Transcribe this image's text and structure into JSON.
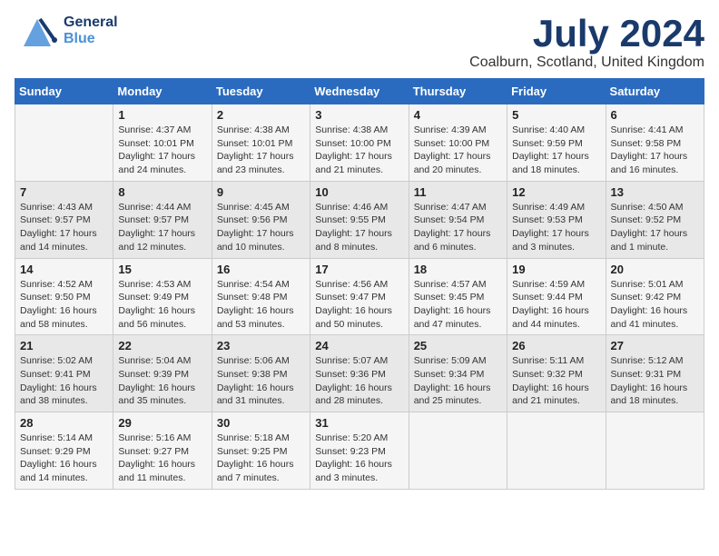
{
  "header": {
    "logo_line1": "General",
    "logo_line2": "Blue",
    "month": "July 2024",
    "location": "Coalburn, Scotland, United Kingdom"
  },
  "weekdays": [
    "Sunday",
    "Monday",
    "Tuesday",
    "Wednesday",
    "Thursday",
    "Friday",
    "Saturday"
  ],
  "weeks": [
    [
      {
        "day": "",
        "info": ""
      },
      {
        "day": "1",
        "info": "Sunrise: 4:37 AM\nSunset: 10:01 PM\nDaylight: 17 hours and 24 minutes."
      },
      {
        "day": "2",
        "info": "Sunrise: 4:38 AM\nSunset: 10:01 PM\nDaylight: 17 hours and 23 minutes."
      },
      {
        "day": "3",
        "info": "Sunrise: 4:38 AM\nSunset: 10:00 PM\nDaylight: 17 hours and 21 minutes."
      },
      {
        "day": "4",
        "info": "Sunrise: 4:39 AM\nSunset: 10:00 PM\nDaylight: 17 hours and 20 minutes."
      },
      {
        "day": "5",
        "info": "Sunrise: 4:40 AM\nSunset: 9:59 PM\nDaylight: 17 hours and 18 minutes."
      },
      {
        "day": "6",
        "info": "Sunrise: 4:41 AM\nSunset: 9:58 PM\nDaylight: 17 hours and 16 minutes."
      }
    ],
    [
      {
        "day": "7",
        "info": "Sunrise: 4:43 AM\nSunset: 9:57 PM\nDaylight: 17 hours and 14 minutes."
      },
      {
        "day": "8",
        "info": "Sunrise: 4:44 AM\nSunset: 9:57 PM\nDaylight: 17 hours and 12 minutes."
      },
      {
        "day": "9",
        "info": "Sunrise: 4:45 AM\nSunset: 9:56 PM\nDaylight: 17 hours and 10 minutes."
      },
      {
        "day": "10",
        "info": "Sunrise: 4:46 AM\nSunset: 9:55 PM\nDaylight: 17 hours and 8 minutes."
      },
      {
        "day": "11",
        "info": "Sunrise: 4:47 AM\nSunset: 9:54 PM\nDaylight: 17 hours and 6 minutes."
      },
      {
        "day": "12",
        "info": "Sunrise: 4:49 AM\nSunset: 9:53 PM\nDaylight: 17 hours and 3 minutes."
      },
      {
        "day": "13",
        "info": "Sunrise: 4:50 AM\nSunset: 9:52 PM\nDaylight: 17 hours and 1 minute."
      }
    ],
    [
      {
        "day": "14",
        "info": "Sunrise: 4:52 AM\nSunset: 9:50 PM\nDaylight: 16 hours and 58 minutes."
      },
      {
        "day": "15",
        "info": "Sunrise: 4:53 AM\nSunset: 9:49 PM\nDaylight: 16 hours and 56 minutes."
      },
      {
        "day": "16",
        "info": "Sunrise: 4:54 AM\nSunset: 9:48 PM\nDaylight: 16 hours and 53 minutes."
      },
      {
        "day": "17",
        "info": "Sunrise: 4:56 AM\nSunset: 9:47 PM\nDaylight: 16 hours and 50 minutes."
      },
      {
        "day": "18",
        "info": "Sunrise: 4:57 AM\nSunset: 9:45 PM\nDaylight: 16 hours and 47 minutes."
      },
      {
        "day": "19",
        "info": "Sunrise: 4:59 AM\nSunset: 9:44 PM\nDaylight: 16 hours and 44 minutes."
      },
      {
        "day": "20",
        "info": "Sunrise: 5:01 AM\nSunset: 9:42 PM\nDaylight: 16 hours and 41 minutes."
      }
    ],
    [
      {
        "day": "21",
        "info": "Sunrise: 5:02 AM\nSunset: 9:41 PM\nDaylight: 16 hours and 38 minutes."
      },
      {
        "day": "22",
        "info": "Sunrise: 5:04 AM\nSunset: 9:39 PM\nDaylight: 16 hours and 35 minutes."
      },
      {
        "day": "23",
        "info": "Sunrise: 5:06 AM\nSunset: 9:38 PM\nDaylight: 16 hours and 31 minutes."
      },
      {
        "day": "24",
        "info": "Sunrise: 5:07 AM\nSunset: 9:36 PM\nDaylight: 16 hours and 28 minutes."
      },
      {
        "day": "25",
        "info": "Sunrise: 5:09 AM\nSunset: 9:34 PM\nDaylight: 16 hours and 25 minutes."
      },
      {
        "day": "26",
        "info": "Sunrise: 5:11 AM\nSunset: 9:32 PM\nDaylight: 16 hours and 21 minutes."
      },
      {
        "day": "27",
        "info": "Sunrise: 5:12 AM\nSunset: 9:31 PM\nDaylight: 16 hours and 18 minutes."
      }
    ],
    [
      {
        "day": "28",
        "info": "Sunrise: 5:14 AM\nSunset: 9:29 PM\nDaylight: 16 hours and 14 minutes."
      },
      {
        "day": "29",
        "info": "Sunrise: 5:16 AM\nSunset: 9:27 PM\nDaylight: 16 hours and 11 minutes."
      },
      {
        "day": "30",
        "info": "Sunrise: 5:18 AM\nSunset: 9:25 PM\nDaylight: 16 hours and 7 minutes."
      },
      {
        "day": "31",
        "info": "Sunrise: 5:20 AM\nSunset: 9:23 PM\nDaylight: 16 hours and 3 minutes."
      },
      {
        "day": "",
        "info": ""
      },
      {
        "day": "",
        "info": ""
      },
      {
        "day": "",
        "info": ""
      }
    ]
  ]
}
